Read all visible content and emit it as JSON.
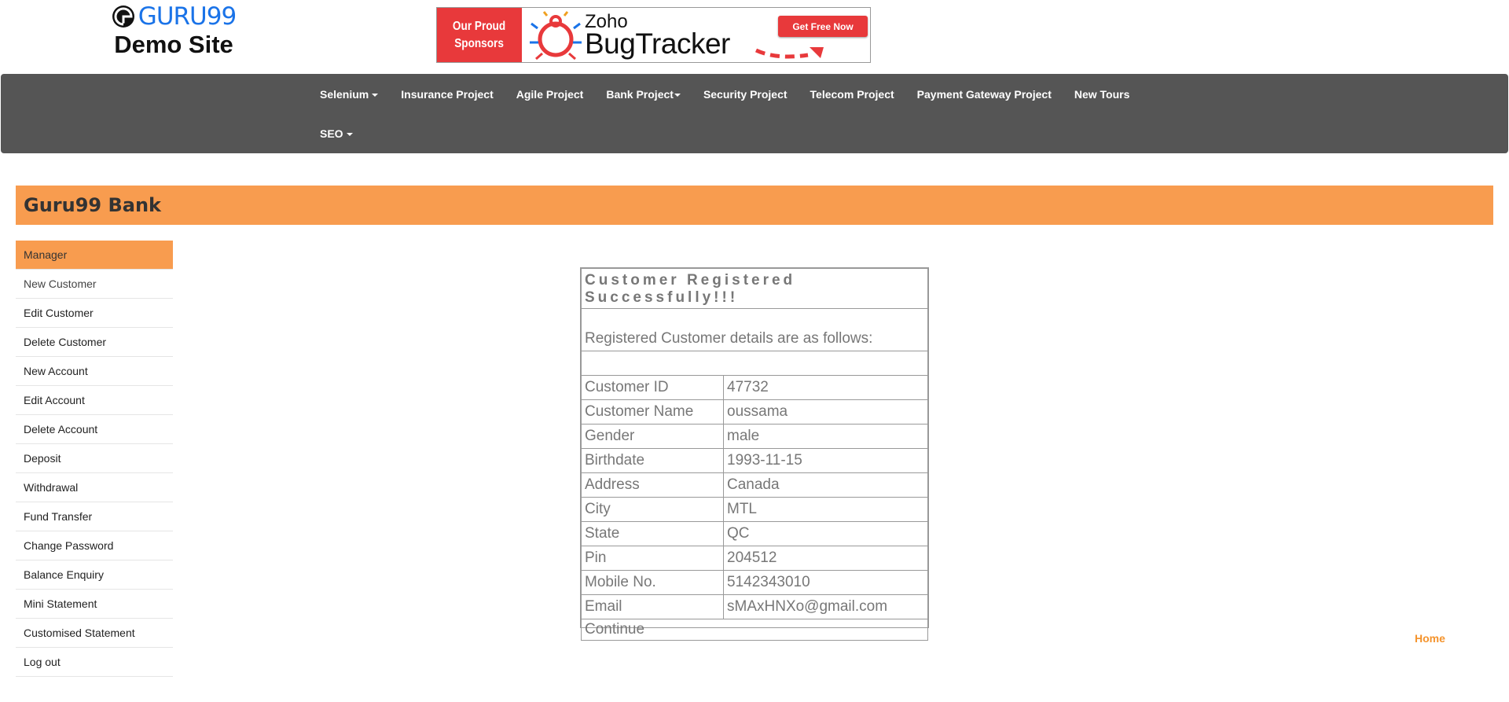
{
  "header": {
    "logo_text": "GURU99",
    "logo_sub": "Demo Site"
  },
  "ad": {
    "sponsor_line1": "Our Proud",
    "sponsor_line2": "Sponsors",
    "brand_top": "Zoho",
    "brand_bottom": "BugTracker",
    "cta": "Get Free Now"
  },
  "nav": {
    "row1": [
      "Selenium",
      "Insurance Project",
      "Agile Project",
      "Bank Project",
      "Security Project",
      "Telecom Project",
      "Payment Gateway Project",
      "New Tours"
    ],
    "row2": [
      "SEO"
    ]
  },
  "bank": {
    "title": "Guru99 Bank"
  },
  "sidebar": {
    "items": [
      "Manager",
      "New Customer",
      "Edit Customer",
      "Delete Customer",
      "New Account",
      "Edit Account",
      "Delete Account",
      "Deposit",
      "Withdrawal",
      "Fund Transfer",
      "Change Password",
      "Balance Enquiry",
      "Mini Statement",
      "Customised Statement",
      "Log out"
    ]
  },
  "result": {
    "success": "Customer Registered Successfully!!!",
    "subtitle": "Registered Customer details are as follows:",
    "rows": [
      {
        "label": "Customer ID",
        "value": "47732"
      },
      {
        "label": "Customer Name",
        "value": "oussama"
      },
      {
        "label": "Gender",
        "value": "male"
      },
      {
        "label": "Birthdate",
        "value": "1993-11-15"
      },
      {
        "label": "Address",
        "value": "Canada"
      },
      {
        "label": "City",
        "value": "MTL"
      },
      {
        "label": "State",
        "value": "QC"
      },
      {
        "label": "Pin",
        "value": "204512"
      },
      {
        "label": "Mobile No.",
        "value": "5142343010"
      },
      {
        "label": "Email",
        "value": "sMAxHNXo@gmail.com"
      }
    ],
    "continue_label": "Continue"
  },
  "footer": {
    "home_label": "Home"
  },
  "colors": {
    "accent_orange": "#f89c4f",
    "navbar": "#555555",
    "logo_blue": "#1a73e8",
    "success_green": "#1f7a1f",
    "link_blue": "#3173c5"
  }
}
